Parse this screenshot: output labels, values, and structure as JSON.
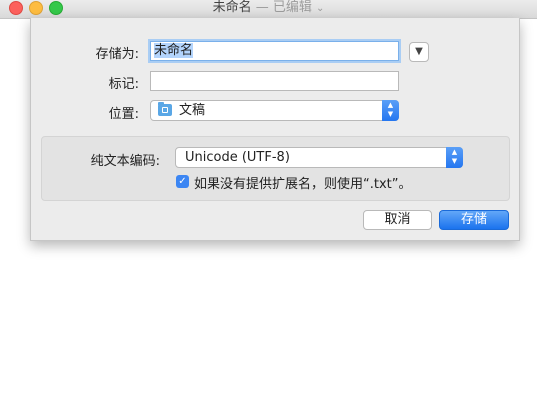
{
  "window": {
    "title": "未命名",
    "edited_suffix": "— 已编辑",
    "title_chevron": "⌄"
  },
  "save_dialog": {
    "save_as_label": "存储为:",
    "filename": "未命名",
    "tags_label": "标记:",
    "tags_value": "",
    "location_label": "位置:",
    "location_value": "文稿",
    "location_icon": "folder-icon",
    "expand_icon": "chevron-down-icon",
    "encoding_label": "纯文本编码:",
    "encoding_value": "Unicode (UTF-8)",
    "extension_checkbox_label": "如果没有提供扩展名，则使用“.txt”。",
    "extension_checkbox_checked": true,
    "cancel_label": "取消",
    "save_label": "存储"
  },
  "colors": {
    "accent": "#2476f0",
    "selection": "#b3d4fc"
  }
}
